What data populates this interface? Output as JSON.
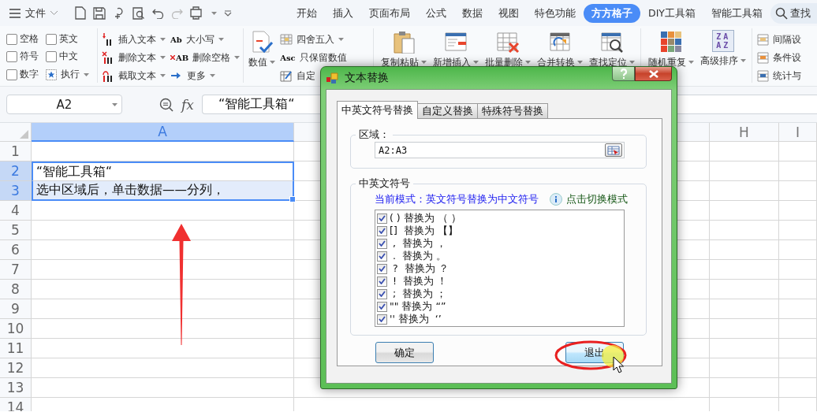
{
  "toolbar": {
    "menu_label": "文件",
    "tabs": [
      {
        "label": "开始",
        "selected": false
      },
      {
        "label": "插入",
        "selected": false
      },
      {
        "label": "页面布局",
        "selected": false
      },
      {
        "label": "公式",
        "selected": false
      },
      {
        "label": "数据",
        "selected": false
      },
      {
        "label": "视图",
        "selected": false
      },
      {
        "label": "特色功能",
        "selected": false
      },
      {
        "label": "方方格子",
        "selected": true
      },
      {
        "label": "DIY工具箱",
        "selected": false
      },
      {
        "label": "智能工具箱",
        "selected": false
      }
    ],
    "search_label": "查找"
  },
  "ribbon": {
    "options": [
      {
        "label": "空格",
        "checked": false
      },
      {
        "label": "英文",
        "checked": false
      },
      {
        "label": "符号",
        "checked": false
      },
      {
        "label": "中文",
        "checked": false
      },
      {
        "label": "数字",
        "checked": false
      }
    ],
    "run_button": {
      "label": "执行",
      "dropdown": true
    },
    "text_tools": [
      {
        "label": "插入文本",
        "dropdown": true
      },
      {
        "label": "删除文本",
        "dropdown": true
      },
      {
        "label": "截取文本",
        "dropdown": true
      },
      {
        "label": "大小写",
        "dropdown": true,
        "icon_text": "Ab"
      },
      {
        "label": "删除空格",
        "dropdown": true,
        "icon_text": "AB"
      },
      {
        "label": "更多",
        "dropdown": true
      }
    ],
    "value_button": {
      "label": "数值",
      "dropdown": true
    },
    "value_tools": [
      {
        "label": "四舍五入",
        "dropdown": true
      },
      {
        "label": "只保留数值",
        "dropdown": false,
        "icon_text": "Asc"
      },
      {
        "label": "自定",
        "dropdown": false
      }
    ],
    "large_buttons": [
      {
        "label": "复制粘贴",
        "dropdown": true
      },
      {
        "label": "新增插入",
        "dropdown": true
      },
      {
        "label": "批量删除",
        "dropdown": true
      },
      {
        "label": "合并转换",
        "dropdown": true
      },
      {
        "label": "查找定位",
        "dropdown": true
      }
    ],
    "order_buttons": [
      {
        "label": "随机重复",
        "dropdown": true
      },
      {
        "label": "高级排序",
        "dropdown": true,
        "icon_lines": [
          "ZA",
          "AZ"
        ]
      }
    ],
    "side_tools": [
      {
        "label": "间隔设"
      },
      {
        "label": "条件设"
      },
      {
        "label": "统计与"
      }
    ]
  },
  "formula_bar": {
    "name_box": "A2",
    "fx_label": "fx",
    "formula": "“智能工具箱“"
  },
  "sheet": {
    "columns": [
      {
        "label": "A",
        "selected": true
      },
      {
        "label": "H",
        "selected": false
      },
      {
        "label": "I",
        "selected": false
      }
    ],
    "rows": [
      {
        "number": "1",
        "selected": false,
        "active": false
      },
      {
        "number": "2",
        "selected": true,
        "active": true,
        "cell_a": "“智能工具箱“"
      },
      {
        "number": "3",
        "selected": true,
        "active": false,
        "cell_a": "选中区域后，单击数据——分列，"
      },
      {
        "number": "4",
        "selected": false,
        "active": false
      },
      {
        "number": "5",
        "selected": false,
        "active": false
      },
      {
        "number": "6",
        "selected": false,
        "active": false
      },
      {
        "number": "7",
        "selected": false,
        "active": false
      },
      {
        "number": "8",
        "selected": false,
        "active": false
      },
      {
        "number": "9",
        "selected": false,
        "active": false
      },
      {
        "number": "10",
        "selected": false,
        "active": false
      },
      {
        "number": "11",
        "selected": false,
        "active": false
      },
      {
        "number": "12",
        "selected": false,
        "active": false
      },
      {
        "number": "13",
        "selected": false,
        "active": false
      },
      {
        "number": "14",
        "selected": false,
        "active": false
      }
    ]
  },
  "dialog": {
    "title": "文本替换",
    "tabs": [
      {
        "label": "中英文符号替换",
        "selected": true
      },
      {
        "label": "自定义替换",
        "selected": false
      },
      {
        "label": "特殊符号替换",
        "selected": false
      }
    ],
    "range": {
      "legend": "区域：",
      "value": "A2:A3"
    },
    "symbols": {
      "legend": "中英文符号",
      "mode": "当前模式：英文符号替换为中文符号",
      "toggle_link": "点击切换模式",
      "items": [
        {
          "label": "( ) 替换为 （ ）",
          "checked": true
        },
        {
          "label": "[]  替换为 【】",
          "checked": true
        },
        {
          "label": " ,  替换为 ，",
          "checked": true
        },
        {
          "label": " .  替换为 。",
          "checked": true
        },
        {
          "label": " ?  替换为 ？",
          "checked": true
        },
        {
          "label": " !  替换为 ！",
          "checked": true
        },
        {
          "label": " ;  替换为 ；",
          "checked": true
        },
        {
          "label": "\"\" 替换为 “”",
          "checked": true
        },
        {
          "label": "'' 替换为  ‘’",
          "checked": true
        }
      ]
    },
    "buttons": [
      {
        "label": "确定",
        "hovered": false
      },
      {
        "label": "退出",
        "hovered": true
      }
    ]
  }
}
